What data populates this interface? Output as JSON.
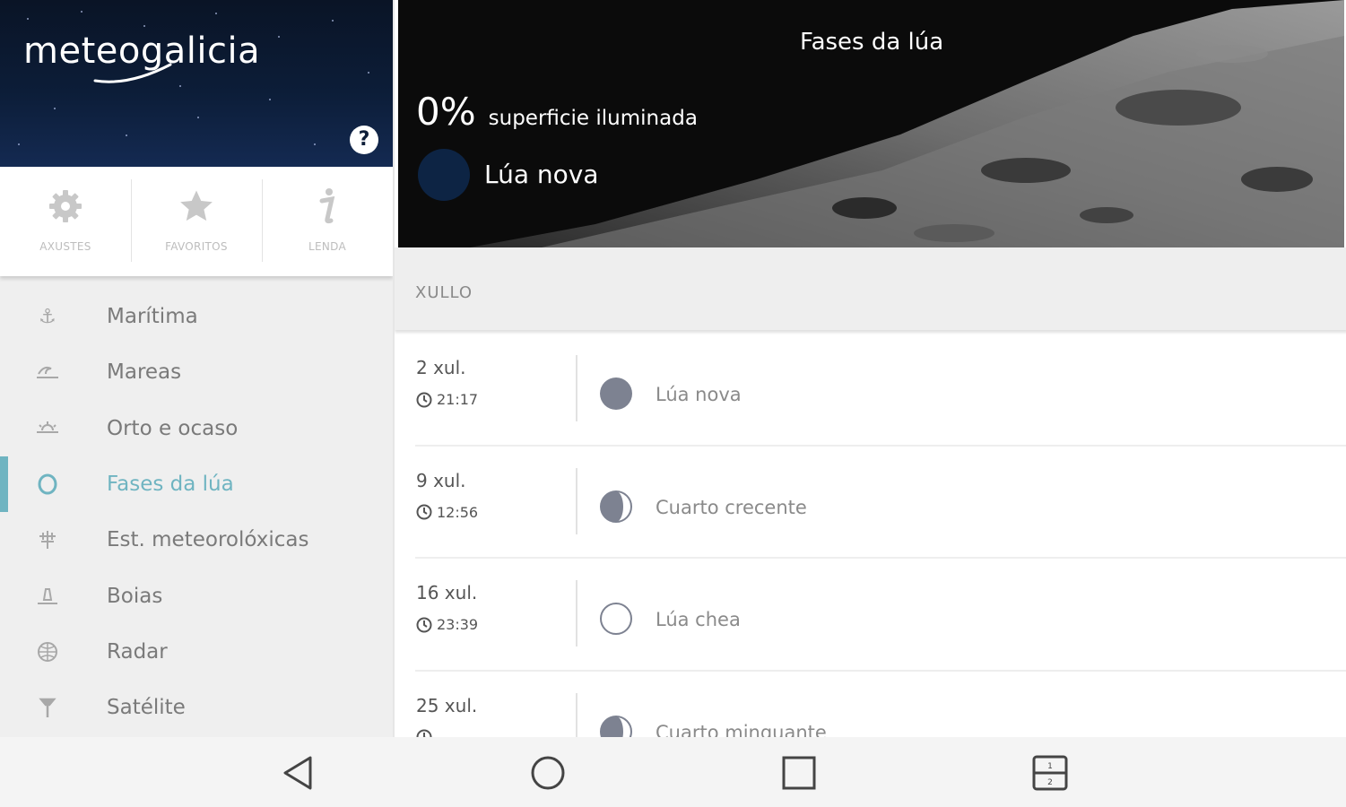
{
  "sidebar": {
    "logo": "meteogalicia",
    "help_label": "?",
    "quick": [
      {
        "label": "AXUSTES",
        "icon": "gear-icon"
      },
      {
        "label": "FAVORITOS",
        "icon": "star-icon"
      },
      {
        "label": "LENDA",
        "icon": "info-icon"
      }
    ],
    "items": [
      {
        "label": "Marítima",
        "icon": "anchor-icon",
        "active": false
      },
      {
        "label": "Mareas",
        "icon": "wave-icon",
        "active": false
      },
      {
        "label": "Orto e ocaso",
        "icon": "sunrise-icon",
        "active": false
      },
      {
        "label": "Fases da lúa",
        "icon": "moon-phase-icon",
        "active": true
      },
      {
        "label": "Est. meteorolóxicas",
        "icon": "station-icon",
        "active": false
      },
      {
        "label": "Boias",
        "icon": "buoy-icon",
        "active": false
      },
      {
        "label": "Radar",
        "icon": "radar-icon",
        "active": false
      },
      {
        "label": "Satélite",
        "icon": "satellite-icon",
        "active": false
      }
    ],
    "accent_color": "#6fb4c1"
  },
  "hero": {
    "title": "Fases da lúa",
    "percent": "0%",
    "percent_label": "superficie iluminada",
    "current_phase": "Lúa nova"
  },
  "month": "XULLO",
  "phases": [
    {
      "date": "2 xul.",
      "time": "21:17",
      "name": "Lúa nova",
      "icon": "new-moon-icon"
    },
    {
      "date": "9 xul.",
      "time": "12:56",
      "name": "Cuarto crecente",
      "icon": "first-quarter-icon"
    },
    {
      "date": "16 xul.",
      "time": "23:39",
      "name": "Lúa chea",
      "icon": "full-moon-icon"
    },
    {
      "date": "25 xul.",
      "time": "",
      "name": "Cuarto minguante",
      "icon": "last-quarter-icon"
    }
  ],
  "system_nav": [
    "back-icon",
    "home-icon",
    "recents-icon",
    "split-screen-icon"
  ]
}
